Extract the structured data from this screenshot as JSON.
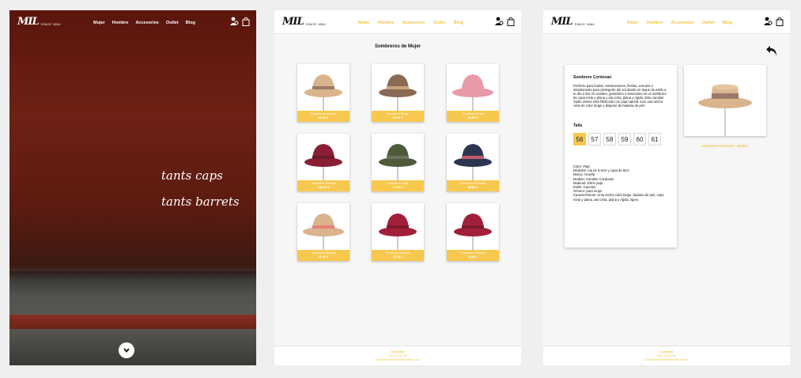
{
  "nav": {
    "logo_text": "MIL",
    "since": "SINCE 1864",
    "items": [
      "Mujer",
      "Hombre",
      "Accesories",
      "Outlet",
      "Blog"
    ]
  },
  "hero": {
    "line1": "tants caps",
    "line2": "tants barrets"
  },
  "catalog": {
    "title": "Sombreros de Mujer",
    "products": [
      {
        "name": "Sombrero Cordovan",
        "price": "89,00 €",
        "color": "#d9b48c",
        "band": "#9a7a6a"
      },
      {
        "name": "Sombrero Mayje",
        "price": "59,50 €",
        "color": "#8a6a55",
        "band": "#c8a47c"
      },
      {
        "name": "Sombrero Chole",
        "price": "59,00 €",
        "color": "#e79aa8",
        "band": "#e79aa8"
      },
      {
        "name": "Sombrero Fedora",
        "price": "146,00 €",
        "color": "#8a1e34",
        "band": "#6e1a28"
      },
      {
        "name": "Sombrero Lady",
        "price": "71,54 €",
        "color": "#4f5a3a",
        "band": "#6b735a"
      },
      {
        "name": "Sombrero Chesden",
        "price": "92,00 €",
        "color": "#2c3550",
        "band": "#c05a6a"
      },
      {
        "name": "Sombrero Mitchell",
        "price": "41,30 €",
        "color": "#d9b48c",
        "band": "#e8817a"
      },
      {
        "name": "Sombrero Pamela",
        "price": "78,95 €",
        "color": "#a21f3a",
        "band": "#7e1a2e"
      },
      {
        "name": "Sombrero Pamela",
        "price": "78,95 €",
        "color": "#a21f3a",
        "band": "#7e1a2e"
      }
    ]
  },
  "detail": {
    "name": "Sombrero Cordovan",
    "description": "Perfecto para bodas, celebraciones, fiestas, eventos o simplemente para protegerte del sol dando un toque de estilo a tu día a día. El canotier, gondolero o veneciano es un sombrero de copa recta y plana y ala corta, plana y rígida. Este canotier rígido unisex está fabricado con paja natural, luce una ancha cinta de color beige y dispone de badana de piel.",
    "size_label": "Talla",
    "sizes": [
      "56",
      "57",
      "58",
      "59",
      "60",
      "61"
    ],
    "selected_size": "56",
    "specs": [
      "Color: Paja",
      "Medidas: Ala de 6,5cm y copa de 8cm",
      "Marca: Gravila",
      "Modelo: Canotier Cordovan",
      "Material: 100% paja",
      "Estilo: Canotier",
      "Género: para mujer",
      "Características: cinta ancha color beige, badana de piel, copa recta y plana, ala corta, plana y rígida, ligero"
    ],
    "caption": "Sombrero Cordovan - 89,00 €"
  },
  "footer": {
    "title": "Contacto",
    "phone": "972 23 51 43",
    "email": "info@barretsmilsince1864.com"
  },
  "colors": {
    "accent": "#f7c84e",
    "hero_bg": "#5e1a10"
  }
}
